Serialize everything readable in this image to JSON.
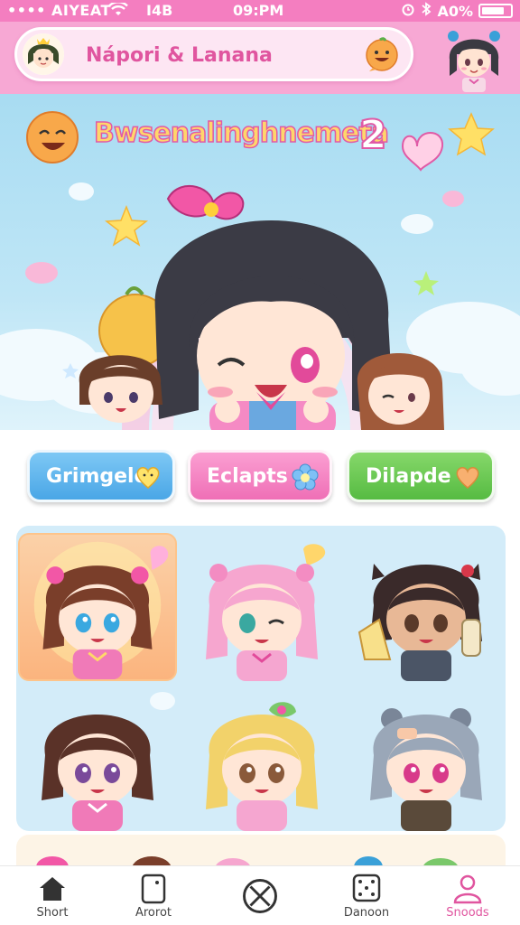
{
  "status_bar": {
    "carrier": "•••• AIYEAT",
    "signal_text": "I4B",
    "time": "09:PM",
    "battery": "A0%"
  },
  "header": {
    "search_text": "Nápori & Lanana",
    "avatar_icon": "chibi-avatar",
    "emoji_icon": "smile-emoji-icon"
  },
  "hero": {
    "title": "Bwsenalinghnemeta",
    "badge": "2"
  },
  "actions": [
    {
      "label": "Grimgele",
      "icon": "heart-icon",
      "color": "#4aa6e6"
    },
    {
      "label": "Eclapts",
      "icon": "flower-icon",
      "color": "#ef6fb6"
    },
    {
      "label": "Dilapde",
      "icon": "heart-icon",
      "color": "#56bb42"
    }
  ],
  "characters": [
    {
      "hair": "#7a3e2a",
      "outfit": "#f07ab8",
      "selected": true
    },
    {
      "hair": "#f6a6cf",
      "outfit": "#f5a6d0",
      "selected": false
    },
    {
      "hair": "#3a2a2a",
      "outfit": "#4b5566",
      "selected": false
    },
    {
      "hair": "#5a3228",
      "outfit": "#f07ab8",
      "selected": false
    },
    {
      "hair": "#f2d26a",
      "outfit": "#f5a6d0",
      "selected": false
    },
    {
      "hair": "#9aa7b8",
      "outfit": "#5a4a3a",
      "selected": false
    }
  ],
  "nav": [
    {
      "label": "Short",
      "icon": "home-icon",
      "active": false
    },
    {
      "label": "Arorot",
      "icon": "card-icon",
      "active": false
    },
    {
      "label": "",
      "icon": "cancel-circle-icon",
      "active": false
    },
    {
      "label": "Danoon",
      "icon": "dice-icon",
      "active": false
    },
    {
      "label": "Snoods",
      "icon": "profile-icon",
      "active": true
    }
  ],
  "colors": {
    "brand_pink": "#f47ec0",
    "header_pink": "#f7a8d4",
    "sky_blue": "#a8dcf2",
    "grid_bg": "#d3ecf9"
  }
}
